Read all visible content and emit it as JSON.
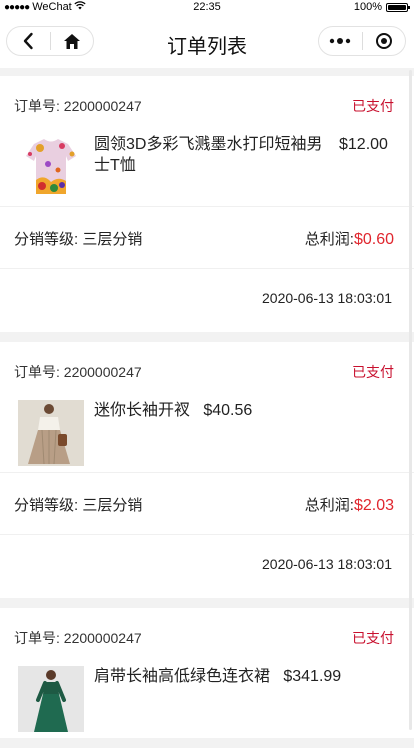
{
  "status_bar": {
    "signal": "●●●●●",
    "carrier": "WeChat",
    "wifi_icon": "wifi-icon",
    "time": "22:35",
    "battery_text": "100%"
  },
  "nav": {
    "title": "订单列表",
    "back_icon": "back-arrow-icon",
    "home_icon": "home-icon",
    "more_icon": "more-dots-icon",
    "close_icon": "target-close-icon"
  },
  "colors": {
    "status_paid": "#c8102e",
    "profit_amount": "#e0262e"
  },
  "orders": [
    {
      "order_no_label": "订单号:",
      "order_no": "2200000247",
      "status": "已支付",
      "product_name": "圆领3D多彩飞溅墨水打印短袖男士T恤",
      "product_price": "$12.00",
      "dist_level": "分销等级: 三层分销",
      "profit_label": "总利润:",
      "profit": "$0.60",
      "time": "2020-06-13 18:03:01"
    },
    {
      "order_no_label": "订单号:",
      "order_no": "2200000247",
      "status": "已支付",
      "product_name": "迷你长袖开衩",
      "product_price": "$40.56",
      "dist_level": "分销等级: 三层分销",
      "profit_label": "总利润:",
      "profit": "$2.03",
      "time": "2020-06-13 18:03:01"
    },
    {
      "order_no_label": "订单号:",
      "order_no": "2200000247",
      "status": "已支付",
      "product_name": "肩带长袖高低绿色连衣裙",
      "product_price": "$341.99"
    }
  ]
}
